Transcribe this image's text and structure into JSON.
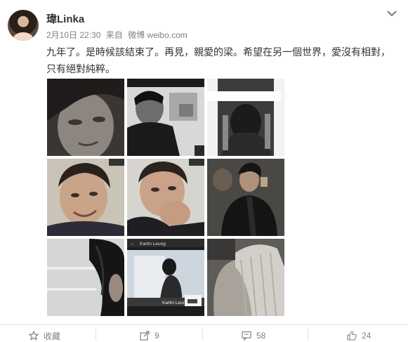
{
  "post": {
    "username": "瑋Linka",
    "date": "2月10日 22:30",
    "source_prefix": "来自",
    "source": "微博 weibo.com",
    "text": "九年了。是時候該結束了。再見，親愛的梁。希望在另一個世界，愛沒有相對，只有絕對純粹。"
  },
  "photos": [
    {
      "name": "photo-1-face-closeup",
      "caption": ""
    },
    {
      "name": "photo-2-man-in-room",
      "caption": ""
    },
    {
      "name": "photo-3-covered-face",
      "caption": ""
    },
    {
      "name": "photo-4-smiling-man",
      "caption": ""
    },
    {
      "name": "photo-5-hand-on-cheek",
      "caption": ""
    },
    {
      "name": "photo-6-leather-jacket",
      "caption": ""
    },
    {
      "name": "photo-7-hair-by-window",
      "caption": ""
    },
    {
      "name": "photo-8-video-screen",
      "caption": "Kartin Leung"
    },
    {
      "name": "photo-9-back-with-towel",
      "caption": ""
    }
  ],
  "photo8": {
    "top_label": "Kartin Leung",
    "bottom_label": "Kartin Leung"
  },
  "actions": {
    "favorite_label": "收藏",
    "repost_count": "9",
    "comment_count": "58",
    "like_count": "24"
  },
  "colors": {
    "text": "#333333",
    "meta": "#808080",
    "background": "#ffffff"
  }
}
